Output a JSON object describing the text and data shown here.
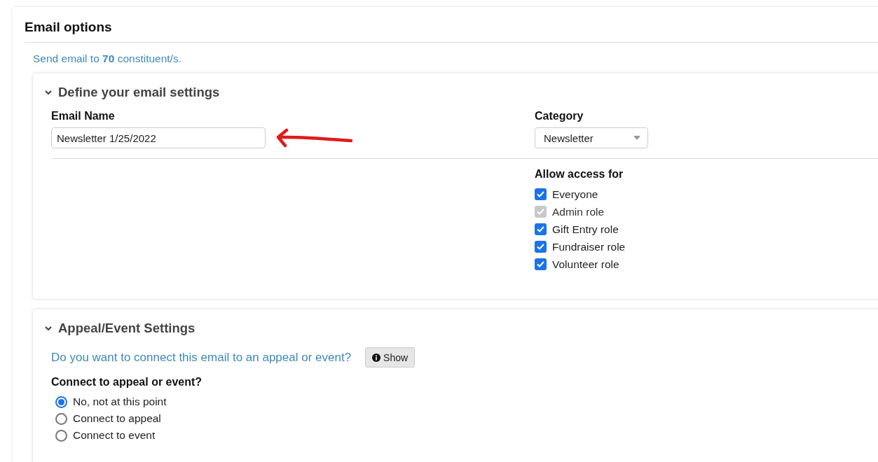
{
  "title": "Email options",
  "recipients_note": "Send email to **70** constituent/s.",
  "settings_section": {
    "title": "Define your email settings",
    "expanded": true,
    "email_name": {
      "label": "Email Name",
      "value": "Newsletter 1/25/2022"
    },
    "category": {
      "label": "Category",
      "value": "Newsletter"
    },
    "access": {
      "label": "Allow access for",
      "options": [
        {
          "label": "Everyone",
          "checked": true,
          "disabled": false
        },
        {
          "label": "Admin role",
          "checked": true,
          "disabled": true
        },
        {
          "label": "Gift Entry role",
          "checked": true,
          "disabled": false
        },
        {
          "label": "Fundraiser role",
          "checked": true,
          "disabled": false
        },
        {
          "label": "Volunteer role",
          "checked": true,
          "disabled": false
        }
      ]
    }
  },
  "appeal_section": {
    "title": "Appeal/Event Settings",
    "expanded": true,
    "question": "Do you want to connect this email to an appeal or event?",
    "show_button": "Show",
    "connect": {
      "label": "Connect to appeal or event?",
      "options": [
        {
          "label": "No, not at this point",
          "selected": true
        },
        {
          "label": "Connect to appeal",
          "selected": false
        },
        {
          "label": "Connect to event",
          "selected": false
        }
      ]
    }
  }
}
